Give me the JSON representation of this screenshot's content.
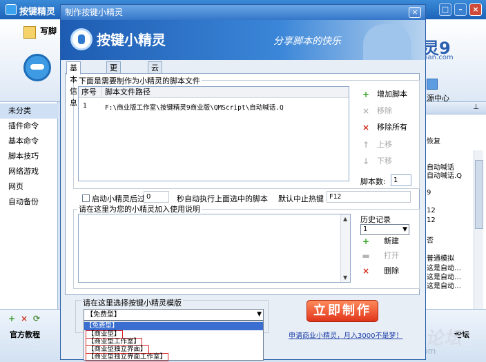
{
  "main_window": {
    "title": "按键精灵",
    "toolbar": {
      "write_label": "写脚",
      "resource_center": "源中心",
      "logo": "灵9",
      "logo_sub": "jian.com"
    },
    "sidebar": [
      "未分类",
      "插件命令",
      "基本命令",
      "脚本技巧",
      "网络游戏",
      "网页",
      "自动备份"
    ],
    "right_panel": [
      "恢复",
      "自动喊话",
      "自动喊话.Q",
      "9",
      "12",
      "12",
      "否",
      "普通模拟",
      "这是自动…",
      "这是自动…",
      "这是自动…"
    ],
    "bottom": {
      "tutorial": "官方教程",
      "forum": "论坛"
    },
    "watermark": "按键精灵论坛",
    "watermark_url": "bbs.anjian.com"
  },
  "dialog": {
    "title": "制作按键小精灵",
    "banner_title": "按键小精灵",
    "banner_slogan": "分享脚本的快乐",
    "tabs": [
      "基本信息",
      "更多设置",
      "云加密"
    ],
    "scripts_group_label": "下面是需要制作为小精灵的脚本文件",
    "table": {
      "headers": [
        "序号",
        "脚本文件路径"
      ],
      "rows": [
        {
          "no": "1",
          "path": "F:\\商业版工作室\\按键精灵9商业版\\QMScript\\自动喊话.Q"
        }
      ]
    },
    "actions": {
      "add": "增加脚本",
      "remove": "移除",
      "remove_all": "移除所有",
      "move_up": "上移",
      "move_down": "下移"
    },
    "script_count_label": "脚本数:",
    "script_count": "1",
    "autostart_label": "启动小精灵后过",
    "autostart_seconds": "0",
    "autostart_suffix": "秒自动执行上面选中的脚本",
    "stop_hotkey_label": "默认中止热键",
    "stop_hotkey": "F12",
    "usage_label": "请在这里为您的小精灵加入使用说明",
    "history": {
      "label": "历史记录",
      "selected": "1",
      "new": "新建",
      "open": "打开",
      "delete": "删除"
    },
    "template": {
      "label": "请在这里选择按键小精灵模版",
      "selected": "【免费型】",
      "options": [
        "【免费型】",
        "【商业型】",
        "【商业型工作室】",
        "【商业型独立界面】",
        "【商业型独立界面工作室】"
      ]
    },
    "make_button": "立即制作",
    "apply_link": "申请商业小精灵，月入3000不是梦！"
  },
  "colors": {
    "accent": "#3677c9",
    "make_button": "#e0361b",
    "highlight": "#3a6fd1"
  }
}
